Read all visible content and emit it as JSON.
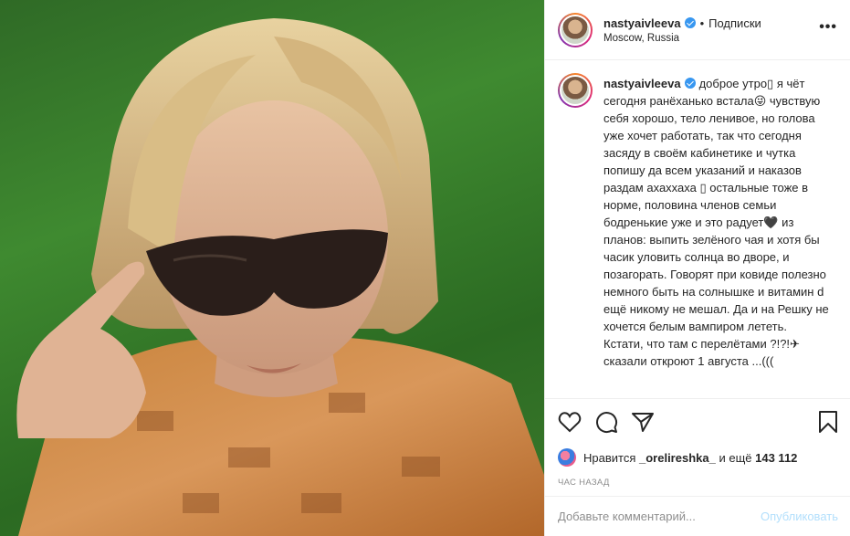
{
  "post": {
    "photo_alt": "",
    "header": {
      "username": "nastyaivleeva",
      "separator": "•",
      "follow_label": "Подписки",
      "location": "Moscow, Russia",
      "more_label": "•••"
    },
    "caption": {
      "username": "nastyaivleeva",
      "text": "доброе утро▯ я чёт сегодня ранёханько встала😜 чувствую себя хорошо, тело ленивое, но голова уже хочет работать, так что сегодня засяду в своём кабинетике и чутка попишу да всем указаний и наказов раздам ахаххаха ▯ остальные тоже в норме, половина членов семьи бодренькие уже и это радует🖤 из планов: выпить зелёного чая и хотя бы часик уловить солнца во дворе, и позагорать. Говорят при ковиде полезно немного быть на солнышке и витамин d ещё никому не мешал. Да и на Решку не хочется белым вампиром лететь. Кстати, что там с перелётами ?!?!✈ сказали откроют 1 августа ...((("
    },
    "likes": {
      "prefix": "Нравится",
      "user": "_orelireshka_",
      "conjunction": "и ещё",
      "count": "143 112"
    },
    "time_ago": "ЧАС НАЗАД",
    "comment_input": {
      "placeholder": "Добавьте комментарий...",
      "value": ""
    },
    "publish_label": "Опубликовать"
  },
  "colors": {
    "accent_blue": "#3897f0",
    "publish_disabled": "#b2dffc",
    "muted": "#8e8e8e",
    "text": "#262626"
  },
  "icons": [
    "heart-icon",
    "comment-icon",
    "share-icon",
    "bookmark-icon",
    "verified-icon",
    "more-icon"
  ]
}
